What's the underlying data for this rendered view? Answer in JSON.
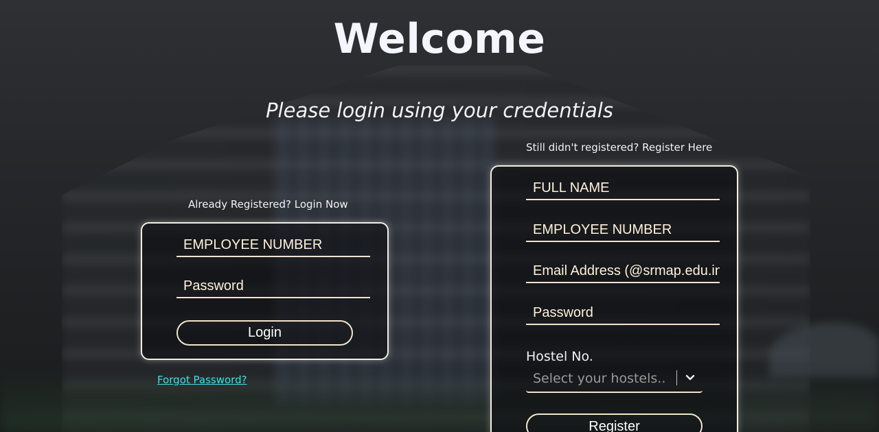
{
  "header": {
    "title": "Welcome",
    "subtitle": "Please login using your credentials"
  },
  "login": {
    "hint": "Already Registered? Login Now",
    "employee_placeholder": "EMPLOYEE NUMBER",
    "password_placeholder": "Password",
    "button_label": "Login",
    "forgot_link": "Forgot Password?"
  },
  "register": {
    "hint": "Still didn't registered? Register Here",
    "full_name_placeholder": "FULL NAME",
    "employee_placeholder": "EMPLOYEE NUMBER",
    "email_placeholder": "Email Address (@srmap.edu.in)",
    "password_placeholder": "Password",
    "hostel_label": "Hostel No.",
    "hostel_select_placeholder": "Select your hostels..",
    "button_label": "Register"
  },
  "colors": {
    "accent_link": "#3fe0e8",
    "border": "#f3e6cf"
  },
  "icons": {
    "dropdown": "chevron-down-icon"
  }
}
